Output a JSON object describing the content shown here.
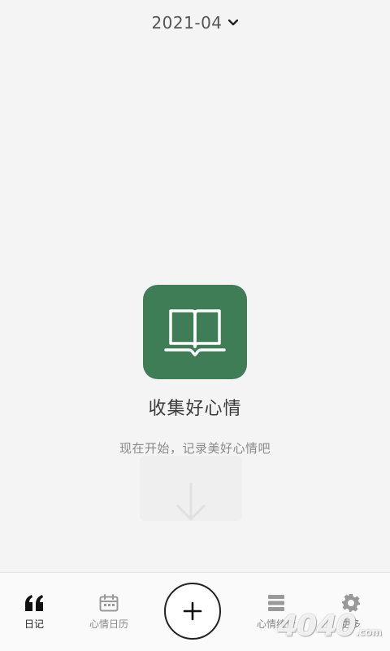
{
  "header": {
    "month": "2021-04"
  },
  "empty_state": {
    "title": "收集好心情",
    "subtitle": "现在开始，记录美好心情吧"
  },
  "bottom_nav": {
    "items": [
      {
        "label": "日记",
        "icon": "quote-icon",
        "active": true
      },
      {
        "label": "心情日历",
        "icon": "calendar-icon",
        "active": false
      },
      {
        "label": "心情统计",
        "icon": "stats-icon",
        "active": false
      },
      {
        "label": "更多",
        "icon": "gear-icon",
        "active": false
      }
    ],
    "add_label": "+"
  },
  "watermark": {
    "text": "4040",
    "suffix": ".com"
  },
  "colors": {
    "accent": "#3f7d57",
    "background": "#f4f4f4"
  }
}
